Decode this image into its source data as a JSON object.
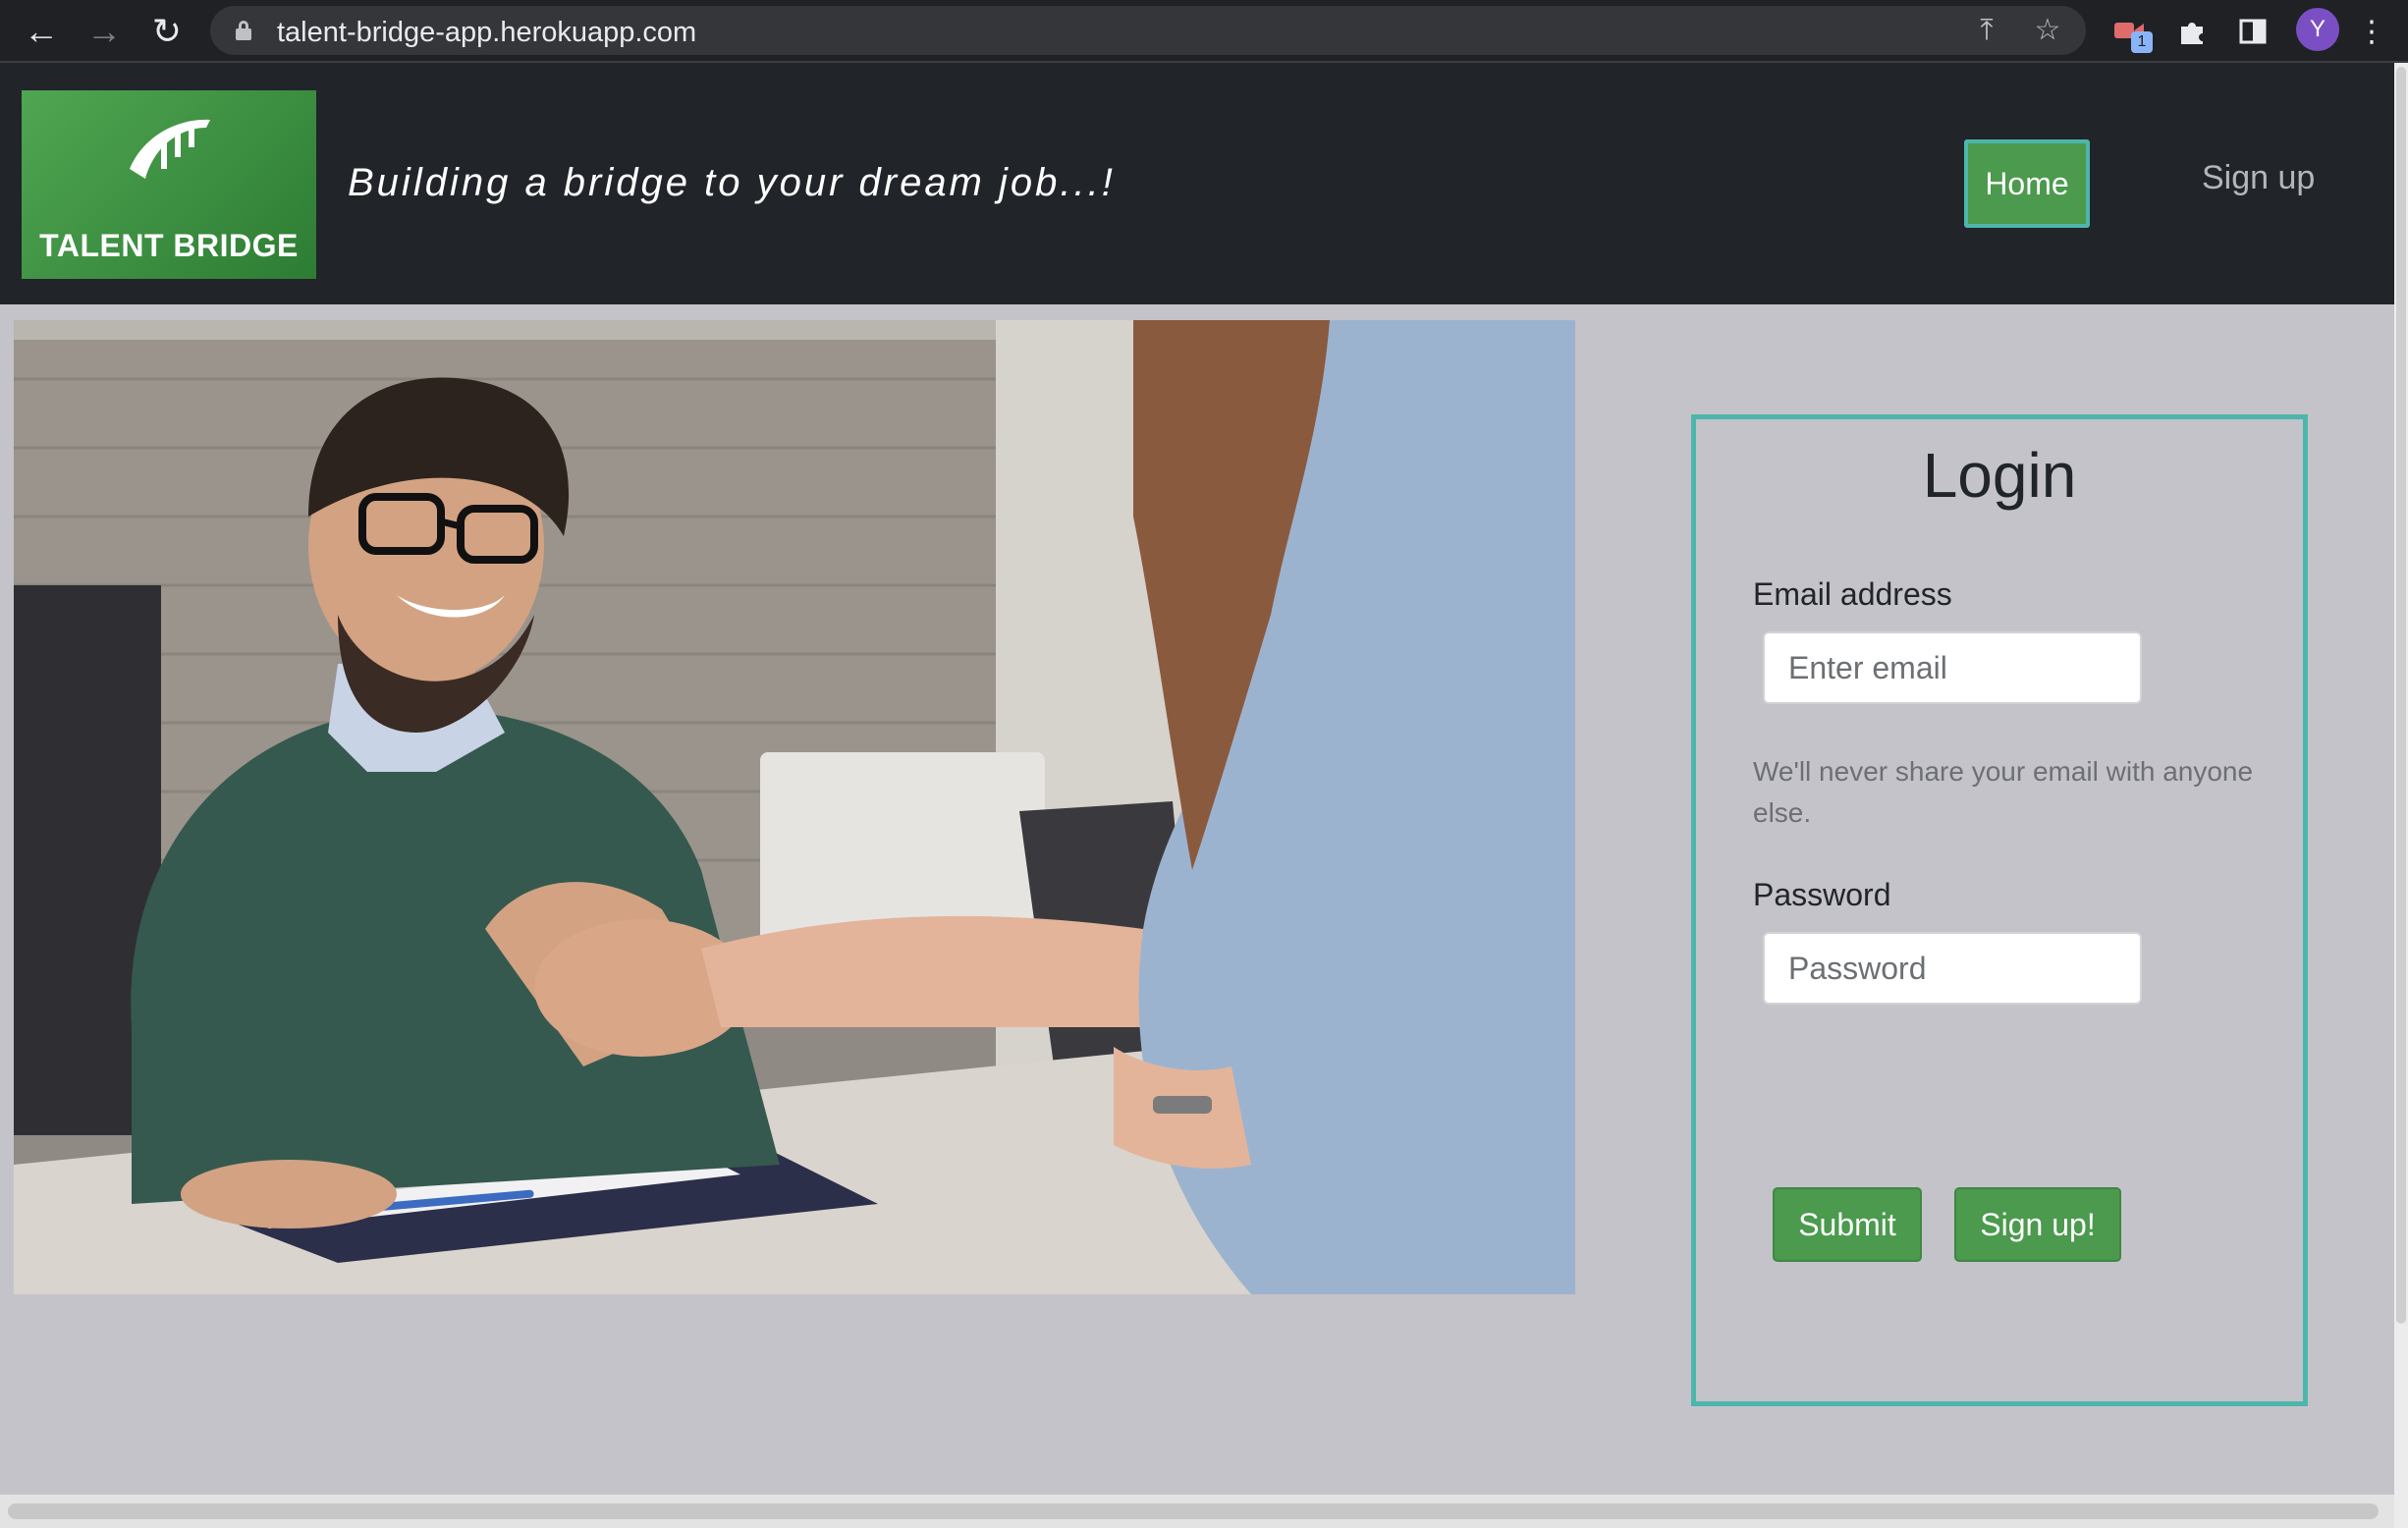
{
  "browser": {
    "url": "talent-bridge-app.herokuapp.com",
    "extension_badge": "1",
    "profile_initial": "Y"
  },
  "header": {
    "logo_text": "TALENT BRIDGE",
    "tagline": "Building a bridge to your dream job...!",
    "nav": {
      "home": "Home",
      "signup": "Sign up"
    }
  },
  "login": {
    "title": "Login",
    "email_label": "Email address",
    "email_placeholder": "Enter email",
    "email_help": "We'll never share your email with anyone else.",
    "password_label": "Password",
    "password_placeholder": "Password",
    "submit_label": "Submit",
    "signup_label": "Sign up!"
  },
  "colors": {
    "brand_green": "#4b9a4d",
    "accent_teal": "#4db6ac",
    "header_bg": "#212429",
    "page_bg": "#c4c3c9"
  }
}
